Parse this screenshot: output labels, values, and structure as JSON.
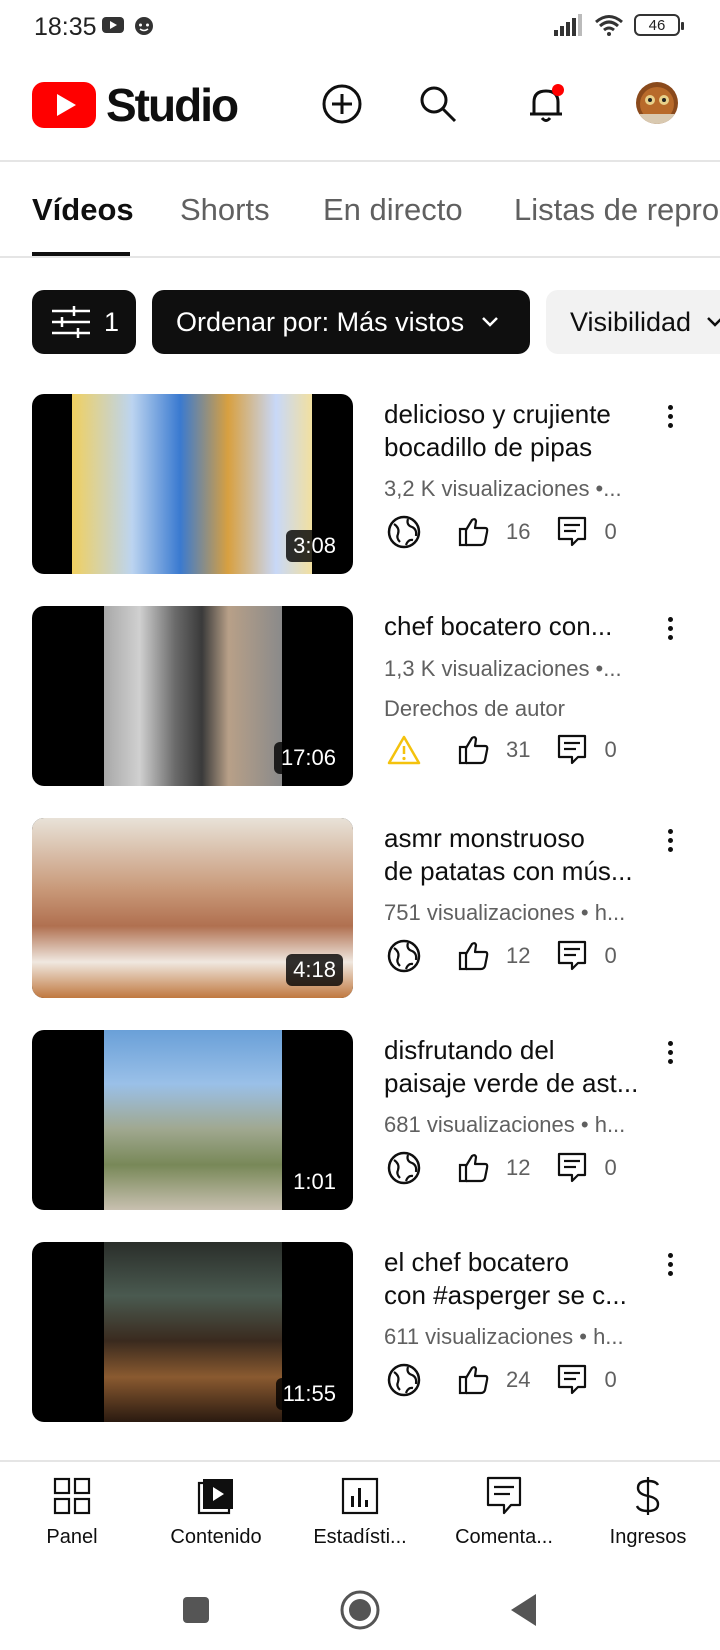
{
  "status_bar": {
    "time": "18:35",
    "battery": "46"
  },
  "header": {
    "logo_text": "Studio",
    "brand_color": "#ff0000"
  },
  "tabs": [
    {
      "label": "Vídeos",
      "active": true
    },
    {
      "label": "Shorts",
      "active": false
    },
    {
      "label": "En directo",
      "active": false
    },
    {
      "label": "Listas de repro",
      "active": false
    }
  ],
  "filters": {
    "filter_count": "1",
    "sort_label": "Ordenar por: Más vistos",
    "visibility_label": "Visibilidad"
  },
  "videos": [
    {
      "title_line1": "delicioso y crujiente",
      "title_line2": "bocadillo de pipas",
      "meta": "3,2 K visualizaciones •...",
      "extra": "",
      "duration": "3:08",
      "visibility_icon": "globe-icon",
      "likes": "16",
      "comments": "0"
    },
    {
      "title_line1": "chef bocatero  con...",
      "title_line2": "",
      "meta": "1,3 K visualizaciones •...",
      "extra": "Derechos de autor",
      "duration": "17:06",
      "visibility_icon": "warning-icon",
      "likes": "31",
      "comments": "0"
    },
    {
      "title_line1": "asmr monstruoso",
      "title_line2": "de patatas con mús...",
      "meta": "751 visualizaciones • h...",
      "extra": "",
      "duration": "4:18",
      "visibility_icon": "globe-icon",
      "likes": "12",
      "comments": "0"
    },
    {
      "title_line1": "disfrutando del",
      "title_line2": "paisaje verde de ast...",
      "meta": "681 visualizaciones • h...",
      "extra": "",
      "duration": "1:01",
      "visibility_icon": "globe-icon",
      "likes": "12",
      "comments": "0"
    },
    {
      "title_line1": "el chef bocatero",
      "title_line2": "con #asperger se c...",
      "meta": "611 visualizaciones • h...",
      "extra": "",
      "duration": "11:55",
      "visibility_icon": "globe-icon",
      "likes": "24",
      "comments": "0"
    }
  ],
  "bottom_nav": [
    {
      "label": "Panel",
      "icon": "dashboard-icon"
    },
    {
      "label": "Contenido",
      "icon": "content-icon"
    },
    {
      "label": "Estadísti...",
      "icon": "analytics-icon"
    },
    {
      "label": "Comenta...",
      "icon": "comments-icon"
    },
    {
      "label": "Ingresos",
      "icon": "dollar-icon"
    }
  ],
  "colors": {
    "warning": "#f4c20d",
    "notification_dot": "#ff0000",
    "text_secondary": "#606060"
  }
}
